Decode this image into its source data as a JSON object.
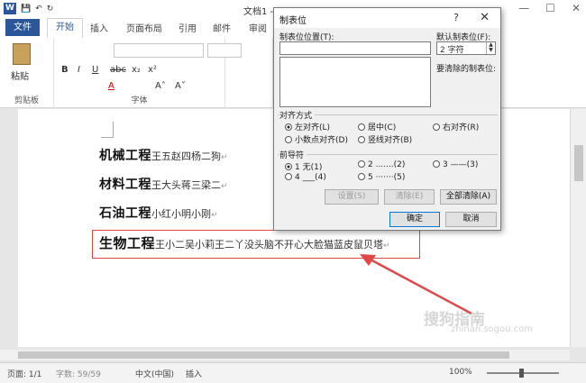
{
  "window": {
    "title": "文档1 - Microsoft Word",
    "minimize": "—",
    "maximize": "☐",
    "close": "✕"
  },
  "qat": {
    "word_icon": "W",
    "save": "💾",
    "undo": "↶",
    "redo": "↻"
  },
  "tabs": [
    "文件",
    "开始",
    "插入",
    "页面布局",
    "引用",
    "邮件",
    "审阅"
  ],
  "ribbon": {
    "paste": "粘贴",
    "clipboard_group": "剪贴板",
    "font_group": "字体",
    "bold": "B",
    "italic": "I",
    "underline": "U",
    "strike": "abc",
    "sub": "x₂",
    "sup": "x²",
    "font_color": "A",
    "grow": "A˄",
    "shrink": "A˅"
  },
  "document": {
    "lines": [
      {
        "head": "机械工程",
        "body": "王五赵四杨二狗",
        "mark": "↵"
      },
      {
        "head": "材料工程",
        "body": "王大头蒋三梁二",
        "mark": "↵"
      },
      {
        "head": "石油工程",
        "body": "小红小明小刚",
        "mark": "↵"
      },
      {
        "head": "生物工程",
        "body": "王小二吴小莉王二丫没头脑不开心大脸猫蓝皮鼠贝塔",
        "mark": "↵"
      }
    ]
  },
  "dialog": {
    "title": "制表位",
    "help": "?",
    "close": "✕",
    "tab_position_label": "制表位位置(T):",
    "tab_position_value": "",
    "default_tab_label": "默认制表位(F):",
    "default_tab_value": "2 字符",
    "to_clear_label": "要清除的制表位:",
    "alignment_label": "对齐方式",
    "alignment": [
      {
        "label": "左对齐(L)",
        "checked": true
      },
      {
        "label": "居中(C)",
        "checked": false
      },
      {
        "label": "右对齐(R)",
        "checked": false
      },
      {
        "label": "小数点对齐(D)",
        "checked": false
      },
      {
        "label": "竖线对齐(B)",
        "checked": false
      }
    ],
    "leader_label": "前导符",
    "leader": [
      {
        "label": "1 无(1)",
        "checked": true
      },
      {
        "label": "2 .......(2)",
        "checked": false
      },
      {
        "label": "3 ——(3)",
        "checked": false
      },
      {
        "label": "4 ___(4)",
        "checked": false
      },
      {
        "label": "5 ·······(5)",
        "checked": false
      }
    ],
    "set_button": "设置(S)",
    "clear_button": "清除(E)",
    "clear_all_button": "全部清除(A)",
    "ok_button": "确定",
    "cancel_button": "取消"
  },
  "status": {
    "page": "页面: 1/1",
    "words": "字数: 59/59",
    "language": "中文(中国)",
    "mode": "插入",
    "zoom": "100%",
    "zoom_level": 1.0
  },
  "watermark": {
    "text": "搜狗指南",
    "sub": "zhinan.sogou.com"
  },
  "colors": {
    "accent": "#2b579a",
    "annotation": "#e04848"
  }
}
